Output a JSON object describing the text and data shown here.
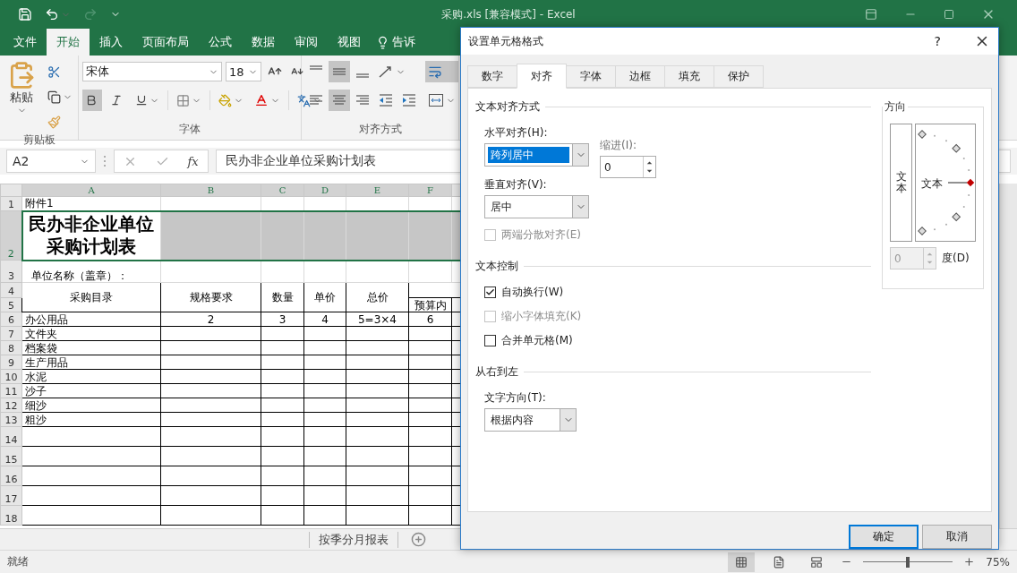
{
  "title_bar": {
    "title": "采购.xls  [兼容模式] - Excel",
    "redo_disabled": true
  },
  "ribbon_tabs": [
    {
      "label": "文件",
      "selected": false
    },
    {
      "label": "开始",
      "selected": true
    },
    {
      "label": "插入",
      "selected": false
    },
    {
      "label": "页面布局",
      "selected": false
    },
    {
      "label": "公式",
      "selected": false
    },
    {
      "label": "数据",
      "selected": false
    },
    {
      "label": "审阅",
      "selected": false
    },
    {
      "label": "视图",
      "selected": false
    }
  ],
  "tell_me": {
    "label": "告诉"
  },
  "ribbon": {
    "clipboard": {
      "paste_label": "粘贴",
      "group_label": "剪贴板"
    },
    "font": {
      "name": "宋体",
      "size": "18",
      "bold": true,
      "italic": false,
      "underline": false,
      "group_label": "字体"
    },
    "alignment": {
      "vertical": [
        {
          "kind": "top",
          "selected": false
        },
        {
          "kind": "middle",
          "selected": true
        },
        {
          "kind": "bottom",
          "selected": false
        }
      ],
      "horizontal": [
        {
          "kind": "left",
          "selected": false
        },
        {
          "kind": "center",
          "selected": true
        },
        {
          "kind": "right",
          "selected": false
        }
      ],
      "wrap_text": true,
      "group_label": "对齐方式"
    }
  },
  "formula_bar": {
    "name_box": "A2",
    "function_label": "fx",
    "formula": "民办非企业单位采购计划表"
  },
  "sheet": {
    "columns": [
      {
        "label": "A",
        "selected": true
      },
      {
        "label": "B",
        "selected": true
      },
      {
        "label": "C",
        "selected": true
      },
      {
        "label": "D",
        "selected": true
      },
      {
        "label": "E",
        "selected": true
      },
      {
        "label": "F",
        "selected": true
      }
    ],
    "rows": [
      {
        "kind": "plain",
        "number": "1",
        "selected": false,
        "cells": [
          "附件1"
        ]
      },
      {
        "kind": "title",
        "number": "2",
        "selected": true,
        "cells": [
          "民办非企业单位采购计划表"
        ]
      },
      {
        "kind": "note",
        "number": "3",
        "selected": false,
        "cells": [
          "单位名称（盖章）："
        ]
      },
      {
        "kind": "header",
        "number": "4",
        "selected": false,
        "cells": [
          "采购目录",
          "规格要求",
          "数量",
          "单价",
          "总价"
        ]
      },
      {
        "kind": "subheader",
        "number": "5",
        "selected": false,
        "cells": [
          "预算内"
        ]
      },
      {
        "kind": "data",
        "number": "6",
        "selected": false,
        "cells": [
          "办公用品",
          "2",
          "3",
          "4",
          "5=3×4",
          "6"
        ]
      },
      {
        "kind": "data",
        "number": "7",
        "selected": false,
        "cells": [
          "文件夹"
        ]
      },
      {
        "kind": "data",
        "number": "8",
        "selected": false,
        "cells": [
          "档案袋"
        ]
      },
      {
        "kind": "data",
        "number": "9",
        "selected": false,
        "cells": [
          "生产用品"
        ]
      },
      {
        "kind": "data",
        "number": "10",
        "selected": false,
        "cells": [
          "水泥"
        ]
      },
      {
        "kind": "data",
        "number": "11",
        "selected": false,
        "cells": [
          "沙子"
        ]
      },
      {
        "kind": "data",
        "number": "12",
        "selected": false,
        "cells": [
          "细沙"
        ]
      },
      {
        "kind": "data",
        "number": "13",
        "selected": false,
        "cells": [
          "粗沙"
        ]
      },
      {
        "kind": "tall",
        "number": "14",
        "selected": false
      },
      {
        "kind": "tall",
        "number": "15",
        "selected": false
      },
      {
        "kind": "tall",
        "number": "16",
        "selected": false
      },
      {
        "kind": "tall",
        "number": "17",
        "selected": false
      },
      {
        "kind": "tall",
        "number": "18",
        "selected": false
      }
    ]
  },
  "sheet_tabs": [
    {
      "label": "按季分月报表",
      "selected": false
    }
  ],
  "status_bar": {
    "status": "就绪",
    "zoom": "75%",
    "zoom_slider": {
      "level": 0.5
    }
  },
  "dialog": {
    "title": "设置单元格格式",
    "help": "?",
    "tabs": [
      {
        "label": "数字",
        "selected": false
      },
      {
        "label": "对齐",
        "selected": true
      },
      {
        "label": "字体",
        "selected": false
      },
      {
        "label": "边框",
        "selected": false
      },
      {
        "label": "填充",
        "selected": false
      },
      {
        "label": "保护",
        "selected": false
      }
    ],
    "text_alignment": {
      "heading": "文本对齐方式",
      "horizontal": {
        "label": "水平对齐(H):",
        "value": "跨列居中",
        "focused": true
      },
      "indent": {
        "label": "缩进(I):",
        "value": "0"
      },
      "vertical": {
        "label": "垂直对齐(V):",
        "value": "居中",
        "focused": false
      },
      "distributed": {
        "label": "两端分散对齐(E)",
        "checked": false,
        "disabled": true
      }
    },
    "text_control": {
      "heading": "文本控制",
      "options": [
        {
          "label": "自动换行(W)",
          "checked": true,
          "disabled": false
        },
        {
          "label": "缩小字体填充(K)",
          "checked": false,
          "disabled": true
        },
        {
          "label": "合并单元格(M)",
          "checked": false,
          "disabled": false
        }
      ]
    },
    "right_to_left": {
      "heading": "从右到左",
      "direction": {
        "label": "文字方向(T):",
        "value": "根据内容",
        "focused": false
      }
    },
    "orientation": {
      "heading": "方向",
      "vertical_text": "文本",
      "dial_text": "文本",
      "degrees": "0",
      "degrees_label": "度(D)"
    },
    "buttons": [
      {
        "label": "确定",
        "kind": "primary"
      },
      {
        "label": "取消",
        "kind": "normal"
      }
    ]
  }
}
